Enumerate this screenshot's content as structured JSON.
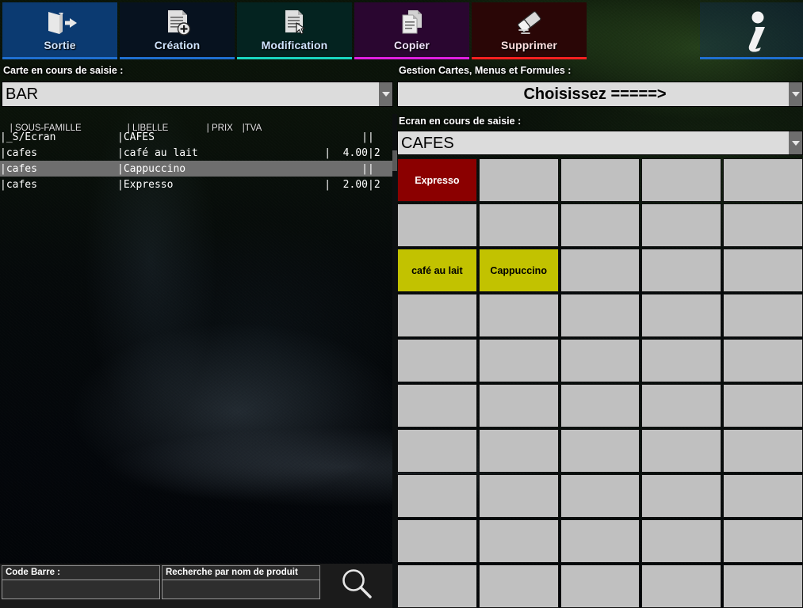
{
  "toolbar": {
    "buttons": [
      {
        "label": "Sortie",
        "icon": "exit-door-icon",
        "accent": "#1f6fd0"
      },
      {
        "label": "Création",
        "icon": "document-add-icon",
        "accent": "#1f6fd0"
      },
      {
        "label": "Modification",
        "icon": "document-edit-icon",
        "accent": "#19d6c0"
      },
      {
        "label": "Copier",
        "icon": "document-copy-icon",
        "accent": "#e01fe0"
      },
      {
        "label": "Supprimer",
        "icon": "eraser-icon",
        "accent": "#ff2020"
      }
    ],
    "info": {
      "icon": "info-italic-i-icon",
      "accent": "#1f6fd0"
    }
  },
  "left": {
    "carte_label": "Carte en cours de saisie :",
    "carte_value": "BAR",
    "columns": {
      "raw_header": "| SOUS-FAMILLE   | LIBELLE             | PRIX  |TVA",
      "sous_famille": "| SOUS-FAMILLE",
      "libelle": "| LIBELLE",
      "prix": "| PRIX",
      "tva": "|TVA"
    },
    "rows": [
      {
        "sous_famille": "|_S/Ecran",
        "libelle": "|CAFES",
        "prix": "|",
        "tva": "|",
        "selected": false
      },
      {
        "sous_famille": "|cafes",
        "libelle": "|café au lait",
        "prix": "|  4.00",
        "tva": "|2",
        "selected": false
      },
      {
        "sous_famille": "|cafes",
        "libelle": "|Cappuccino",
        "prix": "|",
        "tva": "|",
        "selected": true
      },
      {
        "sous_famille": "|cafes",
        "libelle": "|Expresso",
        "prix": "|  2.00",
        "tva": "|2",
        "selected": false
      }
    ],
    "search": {
      "code_barre_label": "Code Barre :",
      "code_barre_value": "",
      "code_barre_placeholder": "",
      "nom_label": "Recherche par nom de produit",
      "nom_value": "",
      "nom_placeholder": "",
      "search_icon": "magnifier-icon"
    }
  },
  "right": {
    "gestion_label": "Gestion Cartes, Menus et Formules  :",
    "gestion_value": "Choisissez  =====>",
    "ecran_label": "Ecran en cours de saisie :",
    "ecran_value": "CAFES",
    "grid": {
      "columns": 5,
      "rows": 10,
      "keys": [
        {
          "label": "Expresso",
          "style": "red"
        },
        {
          "label": "",
          "style": "empty"
        },
        {
          "label": "",
          "style": "empty"
        },
        {
          "label": "",
          "style": "empty"
        },
        {
          "label": "",
          "style": "empty"
        },
        {
          "label": "",
          "style": "empty"
        },
        {
          "label": "",
          "style": "empty"
        },
        {
          "label": "",
          "style": "empty"
        },
        {
          "label": "",
          "style": "empty"
        },
        {
          "label": "",
          "style": "empty"
        },
        {
          "label": "café au lait",
          "style": "yellow"
        },
        {
          "label": "Cappuccino",
          "style": "yellow"
        },
        {
          "label": "",
          "style": "empty"
        },
        {
          "label": "",
          "style": "empty"
        },
        {
          "label": "",
          "style": "empty"
        },
        {
          "label": "",
          "style": "empty"
        },
        {
          "label": "",
          "style": "empty"
        },
        {
          "label": "",
          "style": "empty"
        },
        {
          "label": "",
          "style": "empty"
        },
        {
          "label": "",
          "style": "empty"
        },
        {
          "label": "",
          "style": "empty"
        },
        {
          "label": "",
          "style": "empty"
        },
        {
          "label": "",
          "style": "empty"
        },
        {
          "label": "",
          "style": "empty"
        },
        {
          "label": "",
          "style": "empty"
        },
        {
          "label": "",
          "style": "empty"
        },
        {
          "label": "",
          "style": "empty"
        },
        {
          "label": "",
          "style": "empty"
        },
        {
          "label": "",
          "style": "empty"
        },
        {
          "label": "",
          "style": "empty"
        },
        {
          "label": "",
          "style": "empty"
        },
        {
          "label": "",
          "style": "empty"
        },
        {
          "label": "",
          "style": "empty"
        },
        {
          "label": "",
          "style": "empty"
        },
        {
          "label": "",
          "style": "empty"
        },
        {
          "label": "",
          "style": "empty"
        },
        {
          "label": "",
          "style": "empty"
        },
        {
          "label": "",
          "style": "empty"
        },
        {
          "label": "",
          "style": "empty"
        },
        {
          "label": "",
          "style": "empty"
        },
        {
          "label": "",
          "style": "empty"
        },
        {
          "label": "",
          "style": "empty"
        },
        {
          "label": "",
          "style": "empty"
        },
        {
          "label": "",
          "style": "empty"
        },
        {
          "label": "",
          "style": "empty"
        },
        {
          "label": "",
          "style": "empty"
        },
        {
          "label": "",
          "style": "empty"
        },
        {
          "label": "",
          "style": "empty"
        },
        {
          "label": "",
          "style": "empty"
        },
        {
          "label": "",
          "style": "empty"
        }
      ]
    }
  },
  "colors": {
    "key_red": "#8b0000",
    "key_yellow": "#c2c200",
    "key_empty": "#c0c0c0",
    "selection": "#6e6e6e",
    "combo_bg": "#dcdcdc"
  }
}
